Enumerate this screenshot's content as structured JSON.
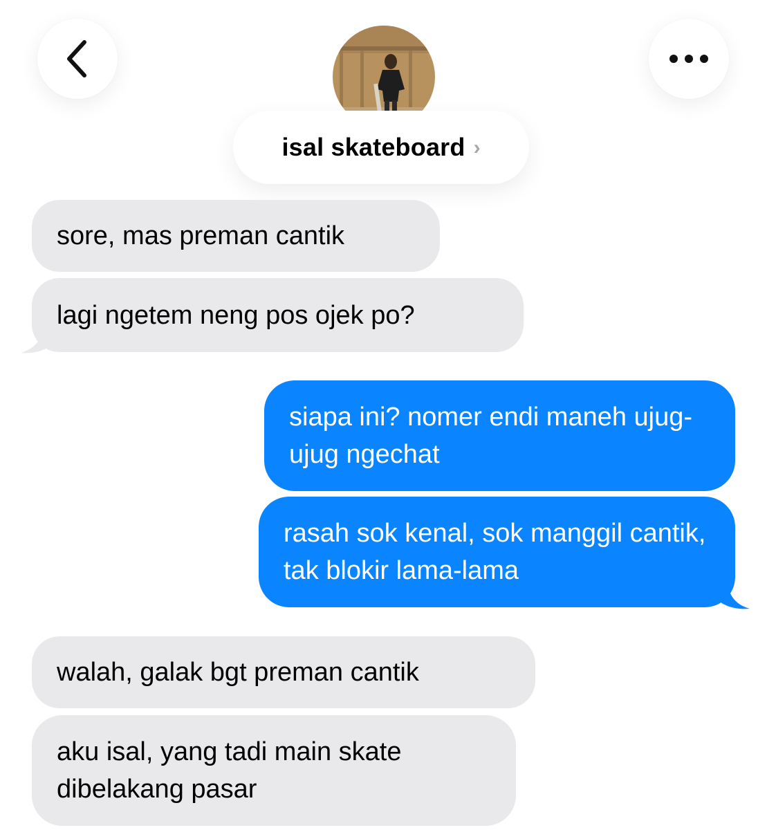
{
  "header": {
    "back_icon": "chevron-left-icon",
    "more_icon": "ellipsis-icon",
    "contact_name": "isal skateboard",
    "name_chevron": "›"
  },
  "colors": {
    "incoming_bubble": "#e9e9eb",
    "outgoing_bubble": "#0a84ff",
    "incoming_text": "#000000",
    "outgoing_text": "#ffffff"
  },
  "messages": [
    {
      "direction": "incoming",
      "text": "sore, mas preman cantik"
    },
    {
      "direction": "incoming",
      "text": "lagi ngetem neng pos ojek po?"
    },
    {
      "direction": "outgoing",
      "text": "siapa ini? nomer endi maneh ujug-ujug ngechat"
    },
    {
      "direction": "outgoing",
      "text": "rasah sok kenal, sok manggil cantik, tak blokir lama-lama"
    },
    {
      "direction": "incoming",
      "text": "walah, galak bgt preman cantik"
    },
    {
      "direction": "incoming",
      "text": "aku isal, yang tadi main skate dibelakang pasar"
    }
  ]
}
